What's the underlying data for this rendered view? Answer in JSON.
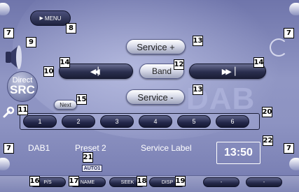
{
  "menu": {
    "label": "MENU"
  },
  "source": {
    "line1": "Direct",
    "line2": "SRC"
  },
  "controls": {
    "service_up": "Service +",
    "service_down": "Service -",
    "band": "Band",
    "next": "Next"
  },
  "presets": [
    "1",
    "2",
    "3",
    "4",
    "5",
    "6"
  ],
  "watermark": "DAB",
  "info": {
    "band": "DAB1",
    "preset": "Preset 2",
    "service_label": "Service Label",
    "clock": "13:50",
    "auto": "AUTO1"
  },
  "function_buttons": [
    "P/S",
    "NAME",
    "SEEK",
    "DISP",
    "-",
    "-"
  ],
  "callouts": {
    "c7": "7",
    "c8": "8",
    "c9": "9",
    "c10": "10",
    "c11": "11",
    "c12": "12",
    "c13": "13",
    "c14": "14",
    "c15": "15",
    "c16": "16",
    "c17": "17",
    "c18": "18",
    "c19": "19",
    "c20": "20",
    "c21": "21",
    "c22": "22"
  },
  "icons": {
    "menu": "play-triangle-icon",
    "prev": "skip-back-icon",
    "next": "skip-forward-icon",
    "speaker": "speaker-icon",
    "wrench": "wrench-icon"
  }
}
